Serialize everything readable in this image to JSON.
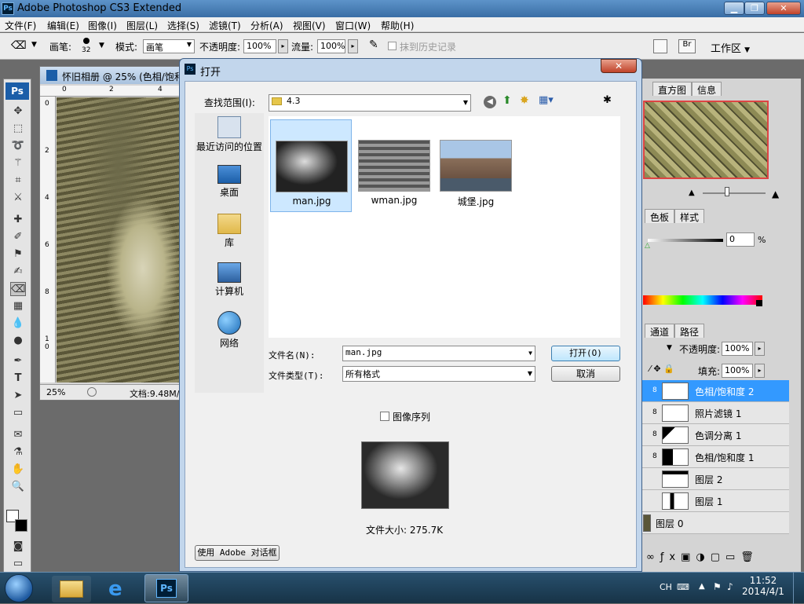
{
  "window": {
    "title": "Adobe Photoshop CS3 Extended",
    "app_icon": "Ps"
  },
  "menu": [
    "文件(F)",
    "编辑(E)",
    "图像(I)",
    "图层(L)",
    "选择(S)",
    "滤镜(T)",
    "分析(A)",
    "视图(V)",
    "窗口(W)",
    "帮助(H)"
  ],
  "options": {
    "brush_label": "画笔:",
    "brush_size": "32",
    "mode_label": "模式:",
    "mode_value": "画笔",
    "opacity_label": "不透明度:",
    "opacity_value": "100%",
    "flow_label": "流量:",
    "flow_value": "100%",
    "history_label": "抹到历史记录",
    "workspace_label": "工作区"
  },
  "toolbox": {
    "logo": "Ps"
  },
  "document": {
    "tab_title": "怀旧相册 @ 25% (色相/饱和",
    "zoom": "25%",
    "doc_info": "文档:9.48M/",
    "ruler_h": [
      "0",
      "2",
      "4"
    ],
    "ruler_v": [
      "0",
      "2",
      "4",
      "6",
      "8",
      "1 0"
    ]
  },
  "dialog": {
    "title": "打开",
    "lookin_label": "查找范围(I):",
    "lookin_value": "4.3",
    "places": [
      {
        "label": "最近访问的位置",
        "icon": "recent-places-icon"
      },
      {
        "label": "桌面",
        "icon": "desktop-icon"
      },
      {
        "label": "库",
        "icon": "library-icon"
      },
      {
        "label": "计算机",
        "icon": "computer-icon"
      },
      {
        "label": "网络",
        "icon": "network-icon"
      }
    ],
    "files": [
      {
        "name": "man.jpg",
        "selected": true
      },
      {
        "name": "wman.jpg",
        "selected": false
      },
      {
        "name": "城堡.jpg",
        "selected": false
      }
    ],
    "filename_label": "文件名(N):",
    "filename_value": "man.jpg",
    "filetype_label": "文件类型(T):",
    "filetype_value": "所有格式",
    "open_button": "打开(O)",
    "cancel_button": "取消",
    "sequence_label": "图像序列",
    "filesize_text": "文件大小: 275.7K",
    "adobe_dialog_button": "使用 Adobe 对话框"
  },
  "panels": {
    "nav_tabs": [
      "直方图",
      "信息"
    ],
    "swatch_tabs": [
      "色板",
      "样式"
    ],
    "slider_value": "0",
    "slider_unit": "%",
    "layers_tabs": [
      "通道",
      "路径"
    ],
    "opacity_label": "不透明度:",
    "opacity_value": "100%",
    "fill_label": "填充:",
    "fill_value": "100%",
    "layers": [
      {
        "name": "色相/饱和度 2",
        "selected": true
      },
      {
        "name": "照片滤镜 1",
        "selected": false
      },
      {
        "name": "色调分离 1",
        "selected": false
      },
      {
        "name": "色相/饱和度 1",
        "selected": false
      },
      {
        "name": "图层 2",
        "selected": false
      },
      {
        "name": "图层 1",
        "selected": false
      },
      {
        "name": "图层 0",
        "selected": false
      }
    ]
  },
  "taskbar": {
    "lang": "CH",
    "time": "11:52",
    "date": "2014/4/1"
  },
  "colors": {
    "selection_blue": "#3399ff",
    "title_blue": "#3a6ea5",
    "taskbar": "#1f3f56"
  }
}
